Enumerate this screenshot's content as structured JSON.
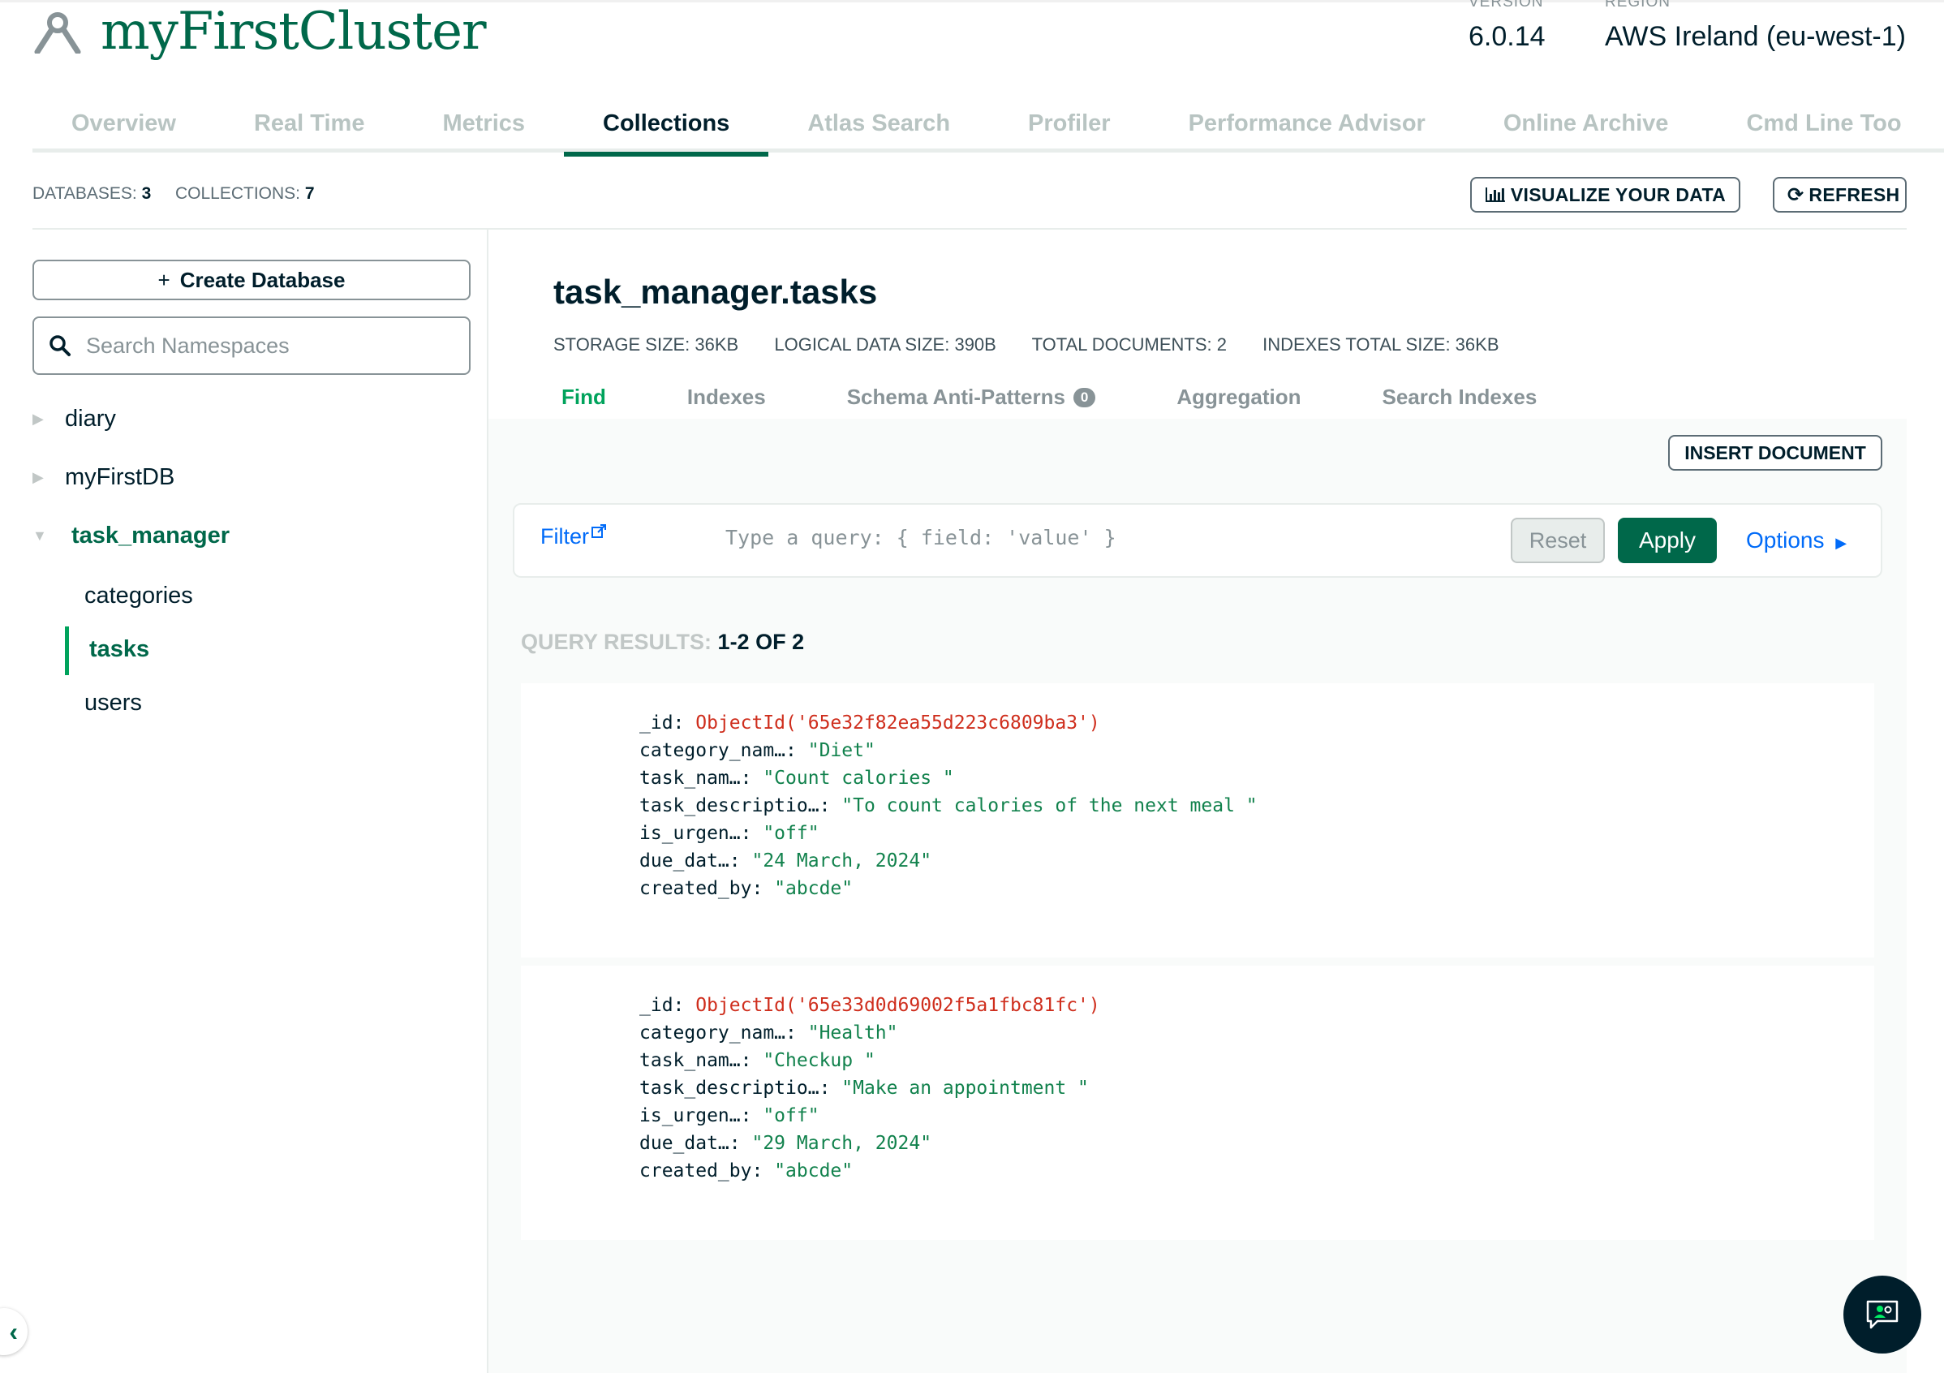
{
  "header": {
    "cluster_name": "myFirstCluster",
    "version_label": "VERSION",
    "version_value": "6.0.14",
    "region_label": "REGION",
    "region_value": "AWS Ireland (eu-west-1)"
  },
  "nav": {
    "tabs": [
      {
        "label": "Overview",
        "active": false
      },
      {
        "label": "Real Time",
        "active": false
      },
      {
        "label": "Metrics",
        "active": false
      },
      {
        "label": "Collections",
        "active": true
      },
      {
        "label": "Atlas Search",
        "active": false
      },
      {
        "label": "Profiler",
        "active": false
      },
      {
        "label": "Performance Advisor",
        "active": false
      },
      {
        "label": "Online Archive",
        "active": false
      },
      {
        "label": "Cmd Line Too",
        "active": false
      }
    ]
  },
  "stats": {
    "databases_label": "DATABASES:",
    "databases_value": "3",
    "collections_label": "COLLECTIONS:",
    "collections_value": "7"
  },
  "toolbar": {
    "visualize_label": "VISUALIZE YOUR DATA",
    "refresh_label": "REFRESH"
  },
  "sidebar": {
    "create_db_label": "Create Database",
    "search_placeholder": "Search Namespaces",
    "databases": [
      {
        "name": "diary",
        "expanded": false
      },
      {
        "name": "myFirstDB",
        "expanded": false
      },
      {
        "name": "task_manager",
        "expanded": true
      }
    ],
    "collections": [
      {
        "name": "categories",
        "active": false
      },
      {
        "name": "tasks",
        "active": true
      },
      {
        "name": "users",
        "active": false
      }
    ]
  },
  "collection": {
    "title": "task_manager.tasks",
    "storage_size": "STORAGE SIZE: 36KB",
    "logical_size": "LOGICAL DATA SIZE: 390B",
    "total_docs": "TOTAL DOCUMENTS: 2",
    "indexes_size": "INDEXES TOTAL SIZE: 36KB",
    "tabs": [
      {
        "label": "Find",
        "active": true
      },
      {
        "label": "Indexes",
        "active": false
      },
      {
        "label": "Schema Anti-Patterns",
        "active": false,
        "badge": "0"
      },
      {
        "label": "Aggregation",
        "active": false
      },
      {
        "label": "Search Indexes",
        "active": false
      }
    ]
  },
  "query": {
    "insert_label": "INSERT DOCUMENT",
    "filter_label": "Filter",
    "filter_placeholder": "Type a query: { field: 'value' }",
    "reset_label": "Reset",
    "apply_label": "Apply",
    "options_label": "Options",
    "results_label": "QUERY RESULTS:",
    "results_value": "1-2 OF 2"
  },
  "documents": [
    {
      "id": "ObjectId('65e32f82ea55d223c6809ba3')",
      "fields": [
        {
          "key": "category_nam…",
          "value": "\"Diet\""
        },
        {
          "key": "task_nam…",
          "value": "\"Count calories \""
        },
        {
          "key": "task_descriptio…",
          "value": "\"To count calories of the next meal \""
        },
        {
          "key": "is_urgen…",
          "value": "\"off\""
        },
        {
          "key": "due_dat…",
          "value": "\"24 March, 2024\""
        },
        {
          "key": "created_by",
          "value": "\"abcde\""
        }
      ]
    },
    {
      "id": "ObjectId('65e33d0d69002f5a1fbc81fc')",
      "fields": [
        {
          "key": "category_nam…",
          "value": "\"Health\""
        },
        {
          "key": "task_nam…",
          "value": "\"Checkup \""
        },
        {
          "key": "task_descriptio…",
          "value": "\"Make an appointment \""
        },
        {
          "key": "is_urgen…",
          "value": "\"off\""
        },
        {
          "key": "due_dat…",
          "value": "\"29 March, 2024\""
        },
        {
          "key": "created_by",
          "value": "\"abcde\""
        }
      ]
    }
  ],
  "colors": {
    "brand_green": "#00684a",
    "accent_green": "#00a35c",
    "link_blue": "#016bf8",
    "objectid_red": "#cf2e1d",
    "string_green": "#12824d"
  }
}
